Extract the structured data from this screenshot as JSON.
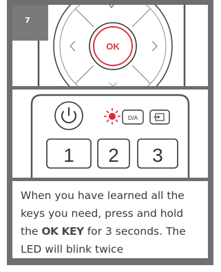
{
  "step": {
    "number": "7"
  },
  "remote": {
    "ok_label": "OK",
    "da_label": "D/A",
    "number_keys": [
      "1",
      "2",
      "3"
    ]
  },
  "instruction": {
    "text_before": "When you have learned all the keys you need, press and hold the ",
    "key_name": "OK KEY",
    "text_after": " for 3 seconds. The LED will blink twice"
  },
  "colors": {
    "frame": "#6f6f6f",
    "ok_accent": "#e0303a",
    "led": "#e52632",
    "outline": "#333333"
  }
}
